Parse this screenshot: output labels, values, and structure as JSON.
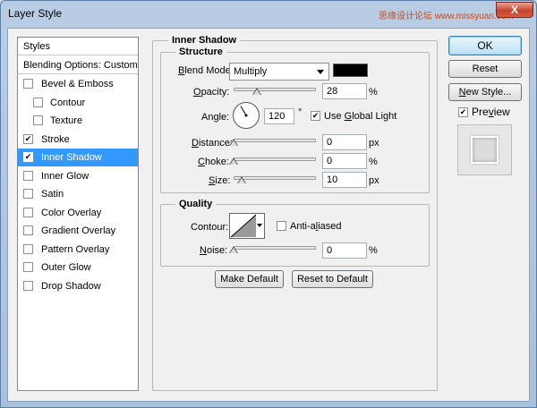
{
  "window": {
    "title": "Layer Style",
    "close": "X",
    "watermark": "思缘设计论坛 www.missyuan.com"
  },
  "style_list": {
    "header": "Styles",
    "blending": "Blending Options: Custom",
    "items": [
      {
        "label": "Bevel & Emboss",
        "checked": false,
        "sub": false,
        "selected": false
      },
      {
        "label": "Contour",
        "checked": false,
        "sub": true,
        "selected": false
      },
      {
        "label": "Texture",
        "checked": false,
        "sub": true,
        "selected": false
      },
      {
        "label": "Stroke",
        "checked": true,
        "sub": false,
        "selected": false
      },
      {
        "label": "Inner Shadow",
        "checked": true,
        "sub": false,
        "selected": true
      },
      {
        "label": "Inner Glow",
        "checked": false,
        "sub": false,
        "selected": false
      },
      {
        "label": "Satin",
        "checked": false,
        "sub": false,
        "selected": false
      },
      {
        "label": "Color Overlay",
        "checked": false,
        "sub": false,
        "selected": false
      },
      {
        "label": "Gradient Overlay",
        "checked": false,
        "sub": false,
        "selected": false
      },
      {
        "label": "Pattern Overlay",
        "checked": false,
        "sub": false,
        "selected": false
      },
      {
        "label": "Outer Glow",
        "checked": false,
        "sub": false,
        "selected": false
      },
      {
        "label": "Drop Shadow",
        "checked": false,
        "sub": false,
        "selected": false
      }
    ]
  },
  "inner_shadow": {
    "title": "Inner Shadow",
    "structure": {
      "title": "Structure",
      "blend_mode_label_pre": "",
      "blend_mode_key": "B",
      "blend_mode_label_post": "lend Mode:",
      "blend_mode_value": "Multiply",
      "shadow_color": "#000000",
      "opacity": {
        "key": "O",
        "rest": "pacity:",
        "value": "28",
        "unit": "%",
        "level": 0.28
      },
      "angle": {
        "label": "Angle:",
        "value": "120",
        "unit": "°",
        "degrees": 120
      },
      "use_global_light": {
        "pre": "Use ",
        "key": "G",
        "post": "lobal Light",
        "checked": true
      },
      "distance": {
        "key": "D",
        "rest": "istance:",
        "value": "0",
        "unit": "px",
        "level": 0.0
      },
      "choke": {
        "key": "C",
        "rest": "hoke:",
        "value": "0",
        "unit": "%",
        "level": 0.0
      },
      "size": {
        "key": "S",
        "rest": "ize:",
        "value": "10",
        "unit": "px",
        "level": 0.1
      }
    },
    "quality": {
      "title": "Quality",
      "contour_label": "Contour:",
      "anti_aliased": {
        "pre": "Anti-a",
        "key": "l",
        "post": "iased",
        "checked": false
      },
      "noise": {
        "key": "N",
        "rest": "oise:",
        "value": "0",
        "unit": "%",
        "level": 0.0
      }
    },
    "make_default": "Make Default",
    "reset_default": "Reset to Default"
  },
  "buttons": {
    "ok": "OK",
    "reset": "Reset",
    "new_style_key": "N",
    "new_style_rest": "ew Style...",
    "preview_pre": "Pre",
    "preview_key": "v",
    "preview_post": "iew",
    "preview_checked": true
  },
  "colors": {
    "selection": "#3399ff",
    "accent_button": "#bfe1f6"
  }
}
